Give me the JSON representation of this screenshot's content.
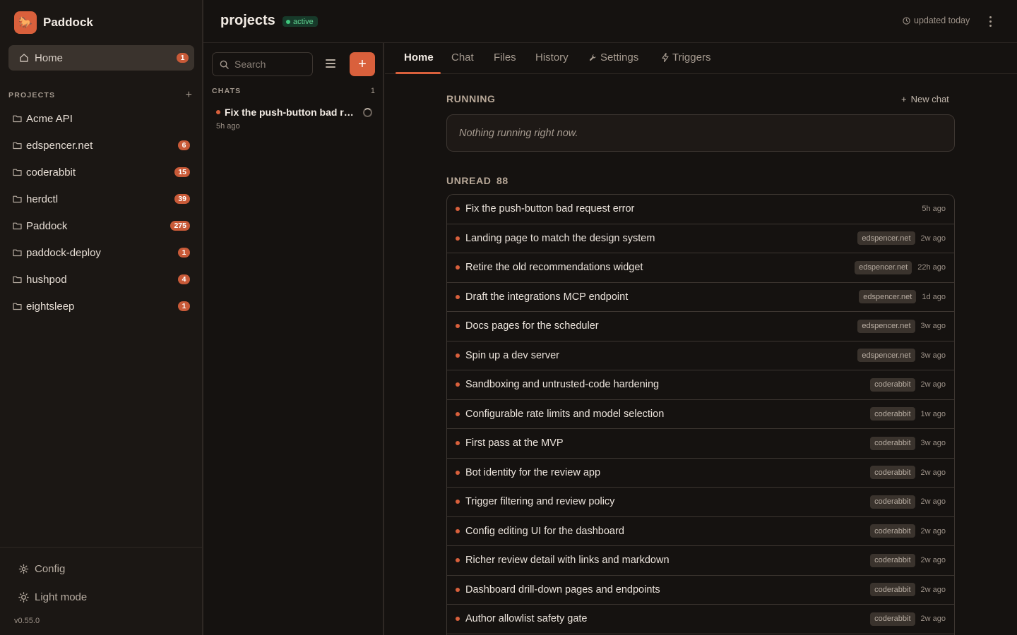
{
  "app": {
    "name": "Paddock"
  },
  "sidebar": {
    "home": {
      "label": "Home",
      "badge": "1"
    },
    "projects_title": "PROJECTS",
    "projects": [
      {
        "name": "Acme API",
        "badge": ""
      },
      {
        "name": "edspencer.net",
        "badge": "6"
      },
      {
        "name": "coderabbit",
        "badge": "15"
      },
      {
        "name": "herdctl",
        "badge": "39"
      },
      {
        "name": "Paddock",
        "badge": "275"
      },
      {
        "name": "paddock-deploy",
        "badge": "1"
      },
      {
        "name": "hushpod",
        "badge": "4"
      },
      {
        "name": "eightsleep",
        "badge": "1"
      }
    ],
    "footer": {
      "config_label": "Config",
      "light_mode_label": "Light mode",
      "version": "v0.55.0"
    }
  },
  "header": {
    "title": "projects",
    "status": "active",
    "updated": "updated today"
  },
  "chats": {
    "search_placeholder": "Search",
    "title": "CHATS",
    "count": "1",
    "items": [
      {
        "title": "Fix the push-button bad request error",
        "time": "5h ago"
      }
    ]
  },
  "tabs": [
    {
      "label": "Home",
      "icon": ""
    },
    {
      "label": "Chat",
      "icon": ""
    },
    {
      "label": "Files",
      "icon": ""
    },
    {
      "label": "History",
      "icon": ""
    },
    {
      "label": "Settings",
      "icon": "wrench-icon"
    },
    {
      "label": "Triggers",
      "icon": "bolt-icon"
    }
  ],
  "running": {
    "title": "RUNNING",
    "new_chat_label": "New chat",
    "empty_text": "Nothing running right now."
  },
  "unread": {
    "title": "UNREAD",
    "count": "88",
    "items": [
      {
        "title": "Fix the push-button bad request error",
        "project": "",
        "time": "5h ago"
      },
      {
        "title": "Landing page to match the design system",
        "project": "edspencer.net",
        "time": "2w ago"
      },
      {
        "title": "Retire the old recommendations widget",
        "project": "edspencer.net",
        "time": "22h ago"
      },
      {
        "title": "Draft the integrations MCP endpoint",
        "project": "edspencer.net",
        "time": "1d ago"
      },
      {
        "title": "Docs pages for the scheduler",
        "project": "edspencer.net",
        "time": "3w ago"
      },
      {
        "title": "Spin up a dev server",
        "project": "edspencer.net",
        "time": "3w ago"
      },
      {
        "title": "Sandboxing and untrusted-code hardening",
        "project": "coderabbit",
        "time": "2w ago"
      },
      {
        "title": "Configurable rate limits and model selection",
        "project": "coderabbit",
        "time": "1w ago"
      },
      {
        "title": "First pass at the MVP",
        "project": "coderabbit",
        "time": "3w ago"
      },
      {
        "title": "Bot identity for the review app",
        "project": "coderabbit",
        "time": "2w ago"
      },
      {
        "title": "Trigger filtering and review policy",
        "project": "coderabbit",
        "time": "2w ago"
      },
      {
        "title": "Config editing UI for the dashboard",
        "project": "coderabbit",
        "time": "2w ago"
      },
      {
        "title": "Richer review detail with links and markdown",
        "project": "coderabbit",
        "time": "2w ago"
      },
      {
        "title": "Dashboard drill-down pages and endpoints",
        "project": "coderabbit",
        "time": "2w ago"
      },
      {
        "title": "Author allowlist safety gate",
        "project": "coderabbit",
        "time": "2w ago"
      }
    ]
  },
  "colors": {
    "accent": "#d9603c",
    "background": "#151210",
    "sidebar": "#1b1714",
    "active_status": "#3fc67c"
  }
}
